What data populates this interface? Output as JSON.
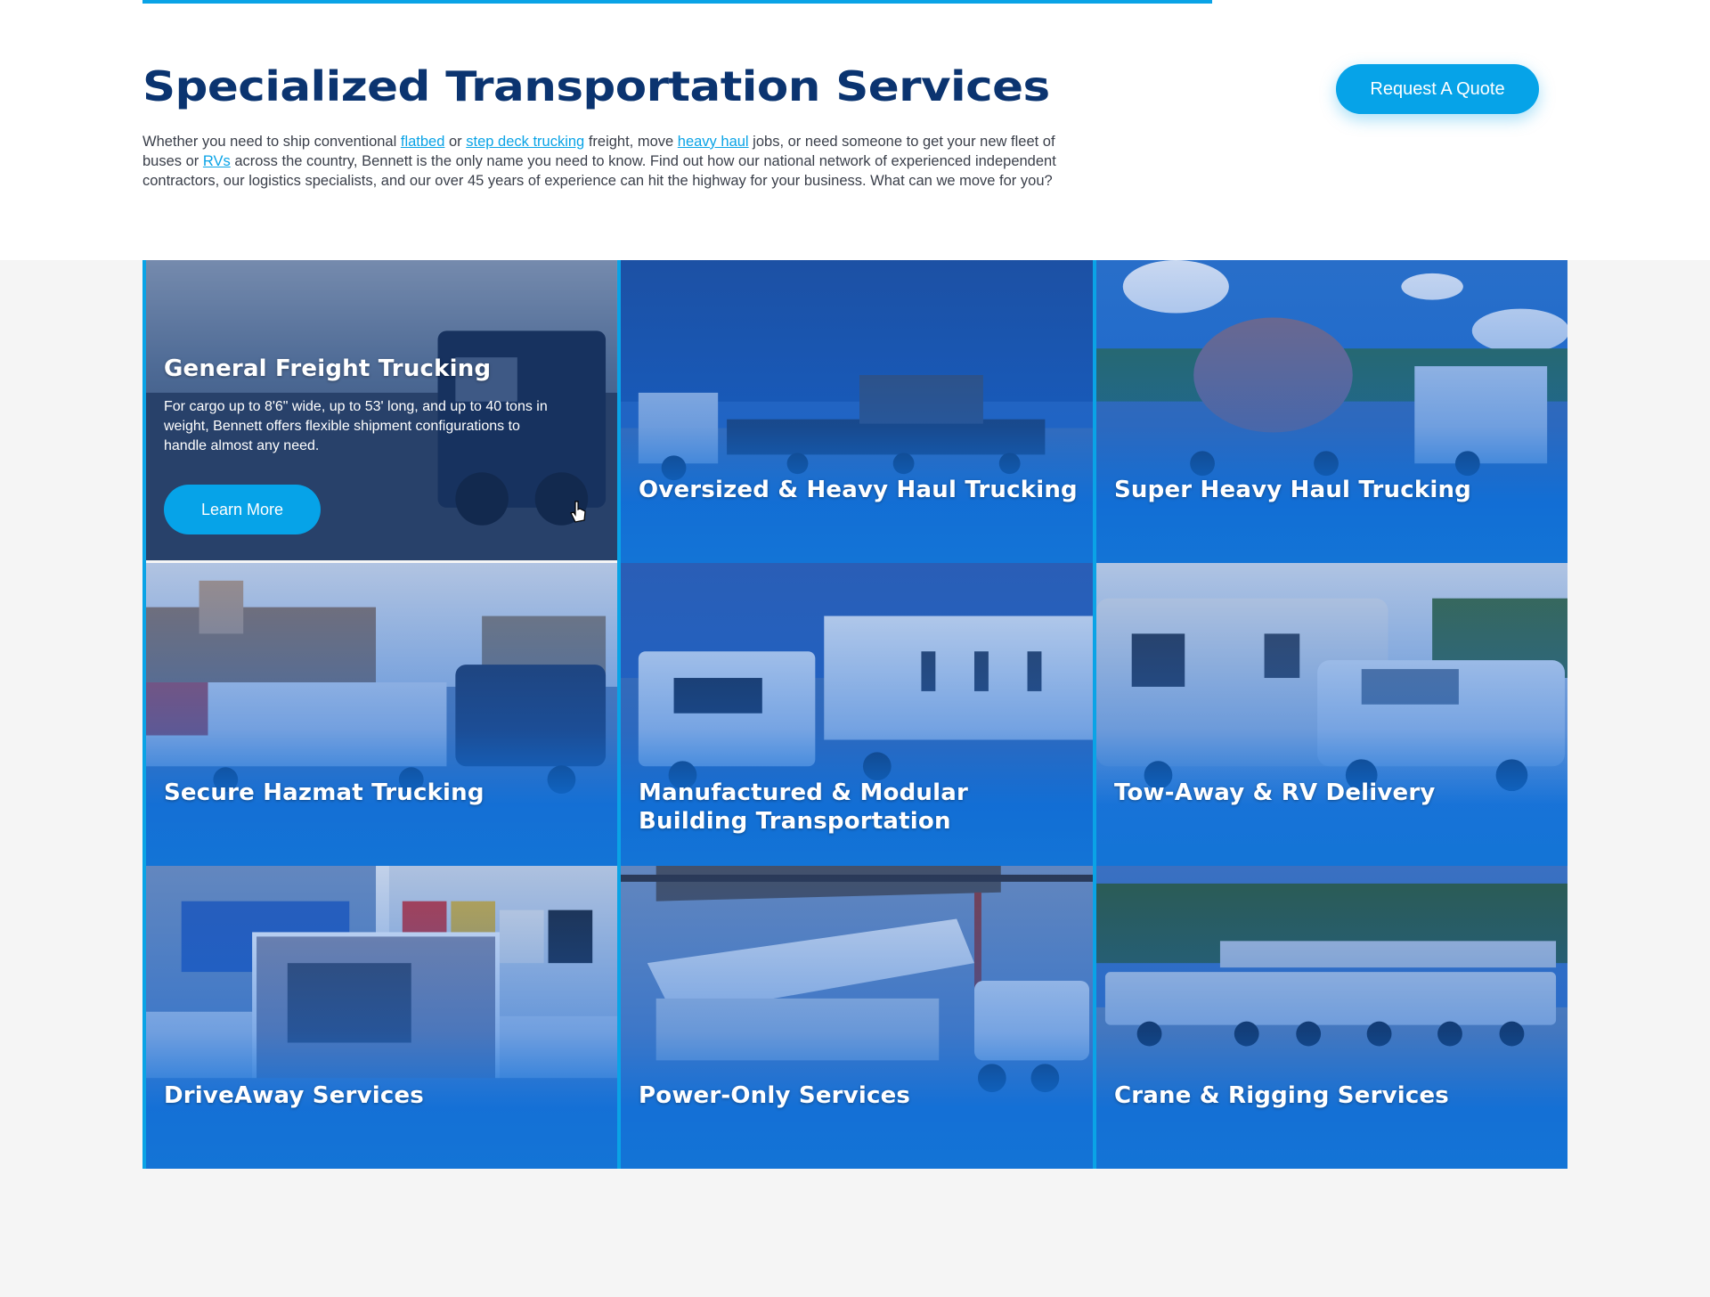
{
  "header": {
    "title": "Specialized Transportation Services",
    "quote_button": "Request A Quote"
  },
  "intro": {
    "t1": "Whether you need to ship conventional ",
    "link_flatbed": "flatbed",
    "t2": " or ",
    "link_step_deck": "step deck trucking",
    "t3": " freight, move ",
    "link_heavy_haul": "heavy haul",
    "t4": " jobs, or need someone to get your new fleet of buses or ",
    "link_rvs": "RVs",
    "t5": " across the country, Bennett is the only name you need to know. Find out how our national network of experienced independent contractors, our logistics specialists, and our over 45 years of experience can hit the highway for your business. What can we move for you?"
  },
  "services": [
    {
      "title": "General Freight Trucking",
      "description": "For cargo up to 8'6\" wide, up to 53' long, and up to 40 tons in weight, Bennett offers flexible shipment configurations to handle almost any need.",
      "button": "Learn More"
    },
    {
      "title": "Oversized & Heavy Haul Trucking"
    },
    {
      "title": "Super Heavy Haul Trucking"
    },
    {
      "title": "Secure Hazmat Trucking"
    },
    {
      "title": "Manufactured & Modular Building Transportation"
    },
    {
      "title": "Tow-Away & RV Delivery"
    },
    {
      "title": "DriveAway Services"
    },
    {
      "title": "Power-Only Services"
    },
    {
      "title": "Crane & Rigging Services"
    }
  ],
  "colors": {
    "brand_navy": "#0b3470",
    "accent_blue": "#06a3e8",
    "card_blue": "#1374d6"
  }
}
